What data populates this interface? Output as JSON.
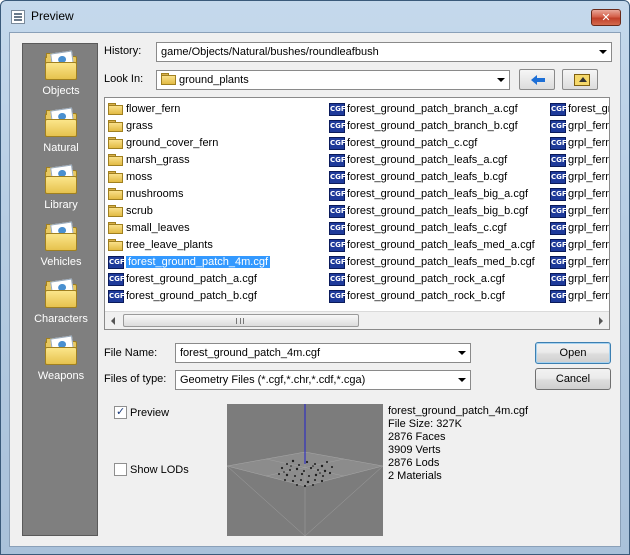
{
  "window": {
    "title": "Preview",
    "close_label": "✕"
  },
  "sidebar": {
    "items": [
      {
        "label": "Objects"
      },
      {
        "label": "Natural"
      },
      {
        "label": "Library"
      },
      {
        "label": "Vehicles"
      },
      {
        "label": "Characters"
      },
      {
        "label": "Weapons"
      }
    ]
  },
  "history": {
    "label": "History:",
    "value": "game/Objects/Natural/bushes/roundleafbush"
  },
  "look_in": {
    "label": "Look In:",
    "value": "ground_plants"
  },
  "files": {
    "col1": [
      {
        "name": "flower_fern",
        "kind": "folder"
      },
      {
        "name": "grass",
        "kind": "folder"
      },
      {
        "name": "ground_cover_fern",
        "kind": "folder"
      },
      {
        "name": "marsh_grass",
        "kind": "folder"
      },
      {
        "name": "moss",
        "kind": "folder"
      },
      {
        "name": "mushrooms",
        "kind": "folder"
      },
      {
        "name": "scrub",
        "kind": "folder"
      },
      {
        "name": "small_leaves",
        "kind": "folder"
      },
      {
        "name": "tree_leave_plants",
        "kind": "folder"
      },
      {
        "name": "forest_ground_patch_4m.cgf",
        "kind": "cgf",
        "selected": true
      },
      {
        "name": "forest_ground_patch_a.cgf",
        "kind": "cgf"
      },
      {
        "name": "forest_ground_patch_b.cgf",
        "kind": "cgf"
      }
    ],
    "col2": [
      "forest_ground_patch_branch_a.cgf",
      "forest_ground_patch_branch_b.cgf",
      "forest_ground_patch_c.cgf",
      "forest_ground_patch_leafs_a.cgf",
      "forest_ground_patch_leafs_b.cgf",
      "forest_ground_patch_leafs_big_a.cgf",
      "forest_ground_patch_leafs_big_b.cgf",
      "forest_ground_patch_leafs_c.cgf",
      "forest_ground_patch_leafs_med_a.cgf",
      "forest_ground_patch_leafs_med_b.cgf",
      "forest_ground_patch_rock_a.cgf",
      "forest_ground_patch_rock_b.cgf"
    ],
    "col3": [
      "forest_gr",
      "grpl_fern_",
      "grpl_fern_",
      "grpl_fern_",
      "grpl_fern_",
      "grpl_fern_",
      "grpl_fern_",
      "grpl_fern_",
      "grpl_fern_",
      "grpl_fern_",
      "grpl_fern_",
      "grpl_fern_"
    ],
    "icon_text": "CGF"
  },
  "scrollbar_grip": "|||",
  "file_name": {
    "label": "File Name:",
    "value": "forest_ground_patch_4m.cgf"
  },
  "file_type": {
    "label": "Files of type:",
    "value": "Geometry Files (*.cgf,*.chr,*.cdf,*.cga)"
  },
  "buttons": {
    "open": "Open",
    "cancel": "Cancel"
  },
  "preview_checkbox": {
    "label": "Preview",
    "checked": true
  },
  "show_lods_checkbox": {
    "label": "Show LODs",
    "checked": false
  },
  "info": {
    "name": "forest_ground_patch_4m.cgf",
    "file_size": "File Size: 327K",
    "faces": "2876 Faces",
    "verts": "3909 Verts",
    "lods": "2876 Lods",
    "materials": "2 Materials"
  }
}
